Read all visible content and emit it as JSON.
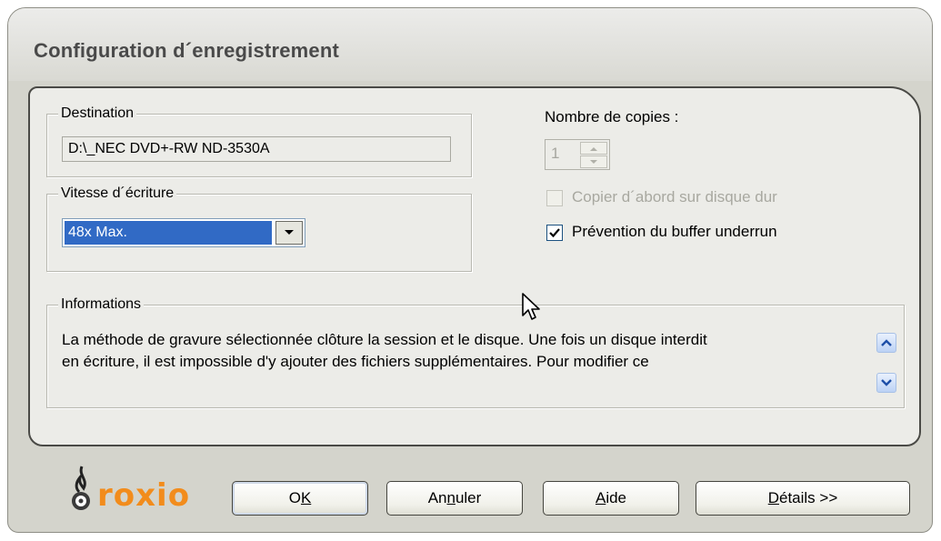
{
  "window": {
    "title": "Configuration d´enregistrement"
  },
  "destination": {
    "legend": "Destination",
    "value": "D:\\_NEC DVD+-RW ND-3530A"
  },
  "speed": {
    "legend": "Vitesse d´écriture",
    "selected": "48x  Max."
  },
  "copies": {
    "label": "Nombre de copies :",
    "value": "1"
  },
  "options": {
    "copy_to_disk": {
      "label": "Copier d´abord sur disque dur",
      "checked": false,
      "enabled": false
    },
    "buffer_underrun": {
      "label": "Prévention du buffer underrun",
      "checked": true,
      "enabled": true
    }
  },
  "info": {
    "legend": "Informations",
    "line1": "La méthode de gravure sélectionnée clôture la session et le disque. Une fois un disque interdit",
    "line2": "en écriture, il est impossible d'y ajouter des fichiers supplémentaires. Pour modifier ce"
  },
  "logo": {
    "text": "roxio"
  },
  "buttons": {
    "ok": {
      "pre": "O",
      "key": "K",
      "post": ""
    },
    "cancel": {
      "pre": "An",
      "key": "n",
      "post": "uler"
    },
    "help": {
      "pre": "",
      "key": "A",
      "post": "ide"
    },
    "details": {
      "pre": "",
      "key": "D",
      "post": "étails >>"
    }
  },
  "colors": {
    "selection": "#316ac5",
    "logo_orange": "#f28c1c",
    "panel": "#ecece8",
    "frame": "#d4d4cc"
  }
}
